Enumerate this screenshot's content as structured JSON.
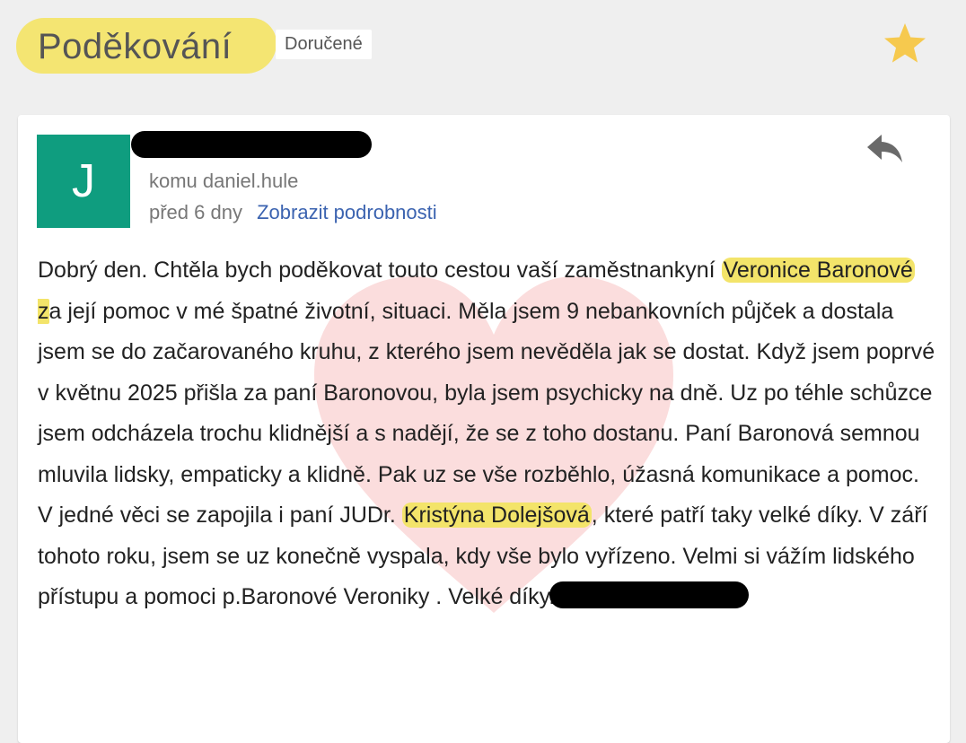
{
  "header": {
    "subject": "Poděkování",
    "label": "Doručené",
    "star_icon": "star-icon",
    "star_color": "#f6c94e",
    "highlight_color": "#f3e46a"
  },
  "message": {
    "avatar_letter": "J",
    "avatar_color": "#0f9d7f",
    "to_line": "komu daniel.hule",
    "time_ago": "před 6 dny",
    "details_link": "Zobrazit podrobnosti",
    "reply_icon": "reply-icon",
    "body": {
      "s1": "Dobrý den. Chtěla bych poděkovat touto cestou vaší zaměstnankyní ",
      "hl1a": "Veronice Baronové",
      "hl1b": " z",
      "s2": "a její pomoc v mé špatné životní, situaci. Měla jsem 9 nebankovních půjček a dostala jsem se do začarovaného kruhu, z kterého jsem nevěděla jak se dostat. Když jsem poprvé v květnu 2025 přišla za paní Baronovou, byla jsem psychicky na dně. Uz po téhle schůzce jsem odcházela trochu klidnější a s nadějí, že se z toho dostanu. Paní Baronová semnou mluvila lidsky, empaticky a klidně. Pak uz se vše rozběhlo, úžasná komunikace a pomoc. V jedné věci se zapojila i paní JUDr. ",
      "hl2": "Kristýna Dolejšová",
      "s3": ", které patří taky velké díky. V září tohoto roku, jsem se uz konečně vyspala, kdy vše bylo vyřízeno. Velmi si vážím lidského přístupu a pomoci p.Baronové Veroniky . Velké díky."
    }
  }
}
